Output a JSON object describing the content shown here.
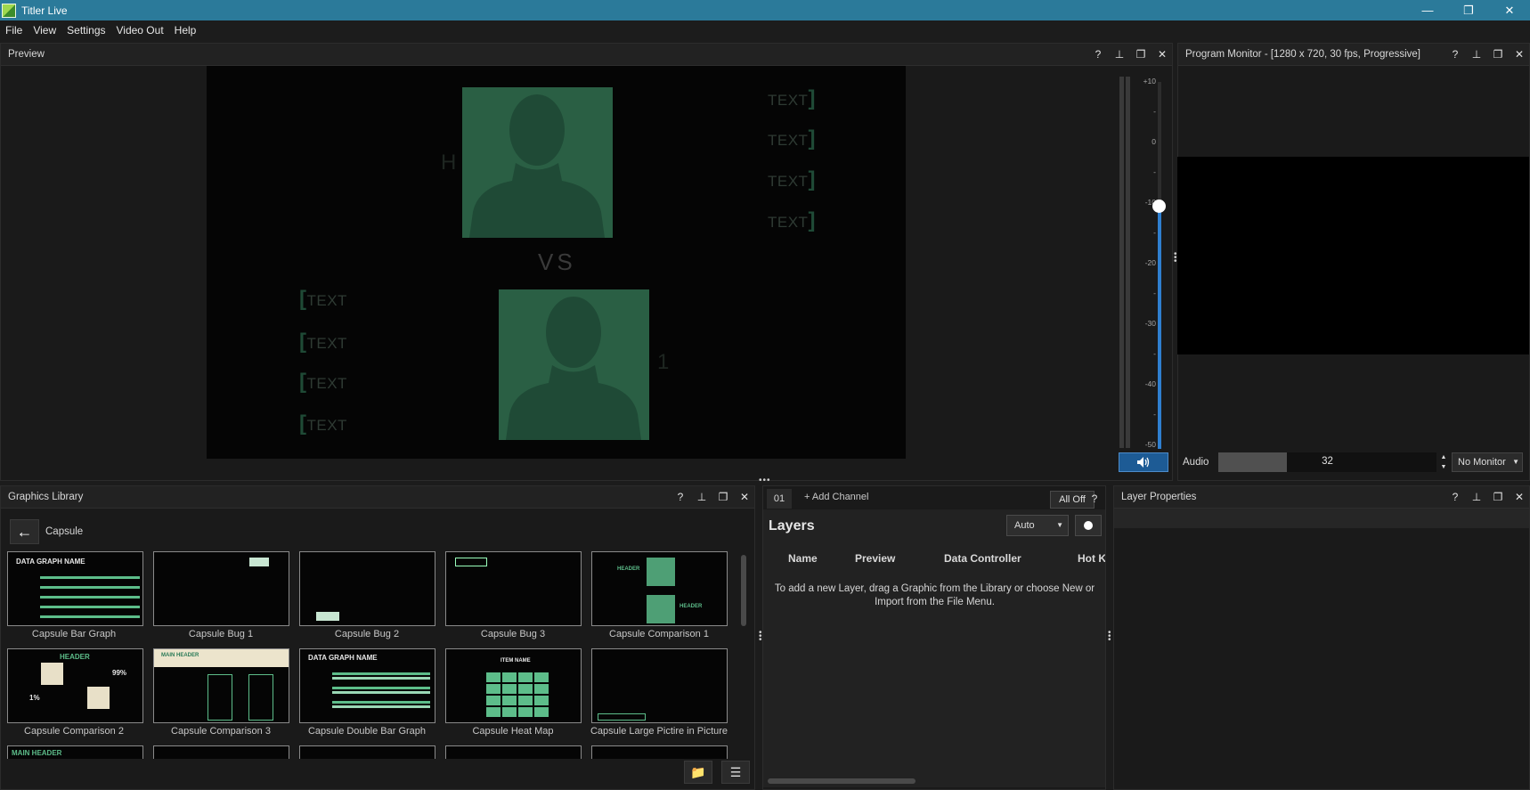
{
  "window": {
    "title": "Titler Live",
    "controls": [
      "minimize",
      "restore",
      "close"
    ]
  },
  "menu": [
    "File",
    "View",
    "Settings",
    "Video Out",
    "Help"
  ],
  "preview": {
    "title": "Preview",
    "canvas": {
      "vs_text": "VS",
      "right_texts": [
        "TEXT",
        "TEXT",
        "TEXT",
        "TEXT"
      ],
      "left_texts": [
        "TEXT",
        "TEXT",
        "TEXT",
        "TEXT"
      ],
      "header_letter": "H",
      "one_glyph": "1"
    },
    "meter_scale": [
      "+10",
      "-",
      "0",
      "-",
      "-10",
      "-",
      "-20",
      "-",
      "-30",
      "-",
      "-40",
      "-",
      "-50"
    ],
    "volume_level_db": -10
  },
  "program_monitor": {
    "title": "Program Monitor - [1280 x 720, 30 fps, Progressive]",
    "audio_label": "Audio",
    "audio_value": "32",
    "monitor_select": "No Monitor"
  },
  "graphics_library": {
    "title": "Graphics Library",
    "folder": "Capsule",
    "items": [
      "Capsule Bar Graph",
      "Capsule Bug 1",
      "Capsule Bug 2",
      "Capsule Bug 3",
      "Capsule Comparison 1",
      "Capsule Comparison 2",
      "Capsule Comparison 3",
      "Capsule Double Bar Graph",
      "Capsule Heat Map",
      "Capsule Large Pictire in Picture"
    ],
    "thumb_text": {
      "data_graph_name": "DATA GRAPH NAME",
      "header": "HEADER",
      "main_header": "MAIN HEADER",
      "item_name": "ITEM NAME",
      "pct_99": "99%",
      "pct_1": "1%",
      "text": "TEXT"
    }
  },
  "channels": {
    "tab": "01",
    "add_channel": "+ Add Channel",
    "all_off": "All Off"
  },
  "layers": {
    "title": "Layers",
    "mode": "Auto",
    "columns": [
      "Name",
      "Preview",
      "Data Controller",
      "Hot K"
    ],
    "empty_message": "To add a new Layer, drag a Graphic from the Library or choose New or Import from the File Menu."
  },
  "layer_properties": {
    "title": "Layer Properties"
  },
  "colors": {
    "titlebar": "#2b7a9a",
    "accent_blue": "#2f7fd0",
    "silhouette_green": "#2a5f44",
    "thumb_green": "#5dbd8a"
  }
}
